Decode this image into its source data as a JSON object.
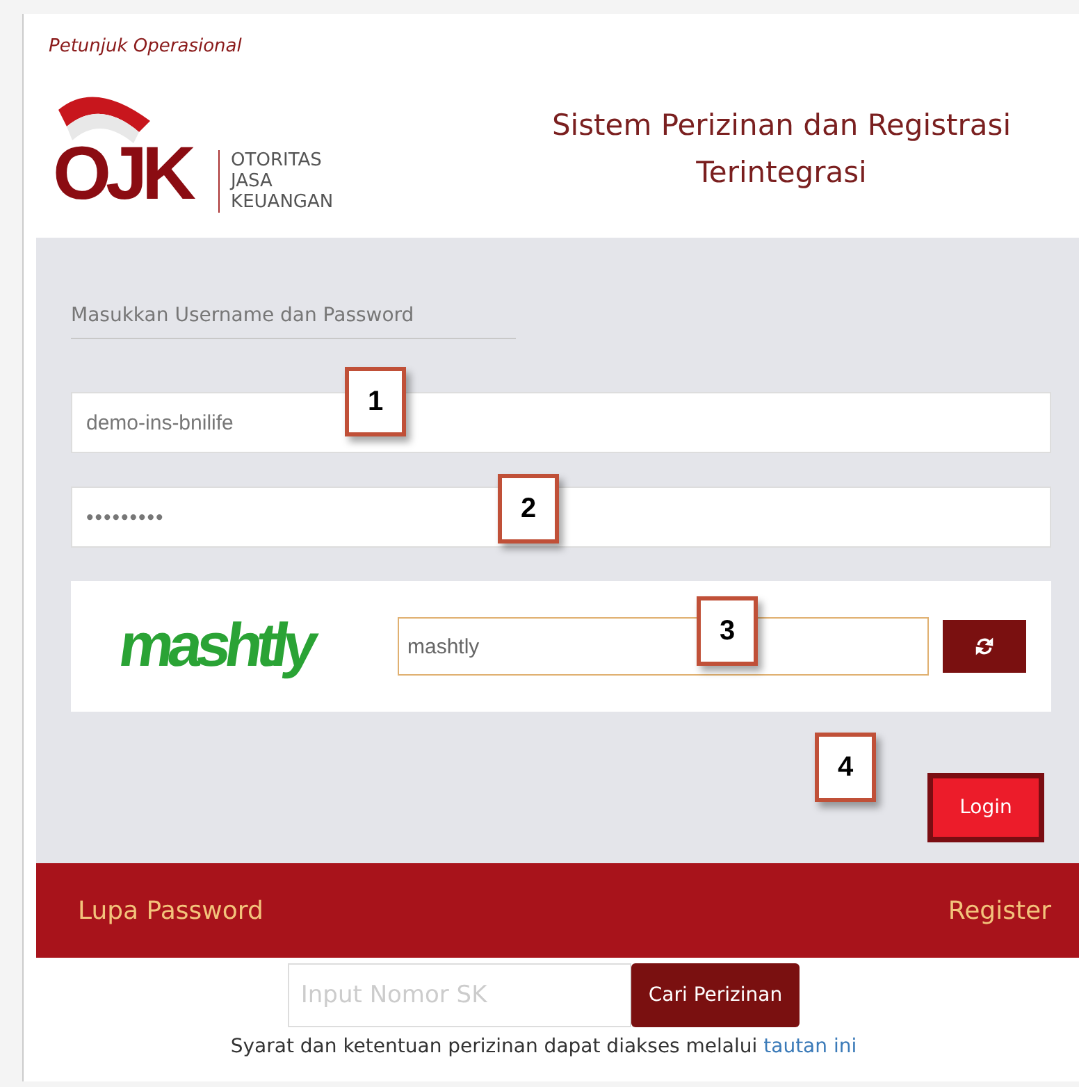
{
  "guide_link": "Petunjuk Operasional",
  "logo": {
    "mark": "OJK",
    "lines": [
      "OTORITAS",
      "JASA",
      "KEUANGAN"
    ]
  },
  "title": "Sistem Perizinan dan Registrasi Terintegrasi",
  "form": {
    "heading": "Masukkan Username dan Password",
    "username": {
      "value": "demo-ins-bnilife"
    },
    "password": {
      "value": "•••••••••"
    },
    "captcha": {
      "image_text": "mashtly",
      "value": "mashtly",
      "focused": true
    },
    "login_button": "Login"
  },
  "footer_bar": {
    "left": "Lupa Password",
    "right": "Register"
  },
  "search": {
    "placeholder": "Input Nomor SK",
    "button": "Cari Perizinan"
  },
  "terms": {
    "text": "Syarat dan ketentuan perizinan dapat diakses melalui ",
    "link": "tautan ini"
  },
  "annotations": [
    {
      "label": "1"
    },
    {
      "label": "2"
    },
    {
      "label": "3"
    },
    {
      "label": "4"
    }
  ]
}
